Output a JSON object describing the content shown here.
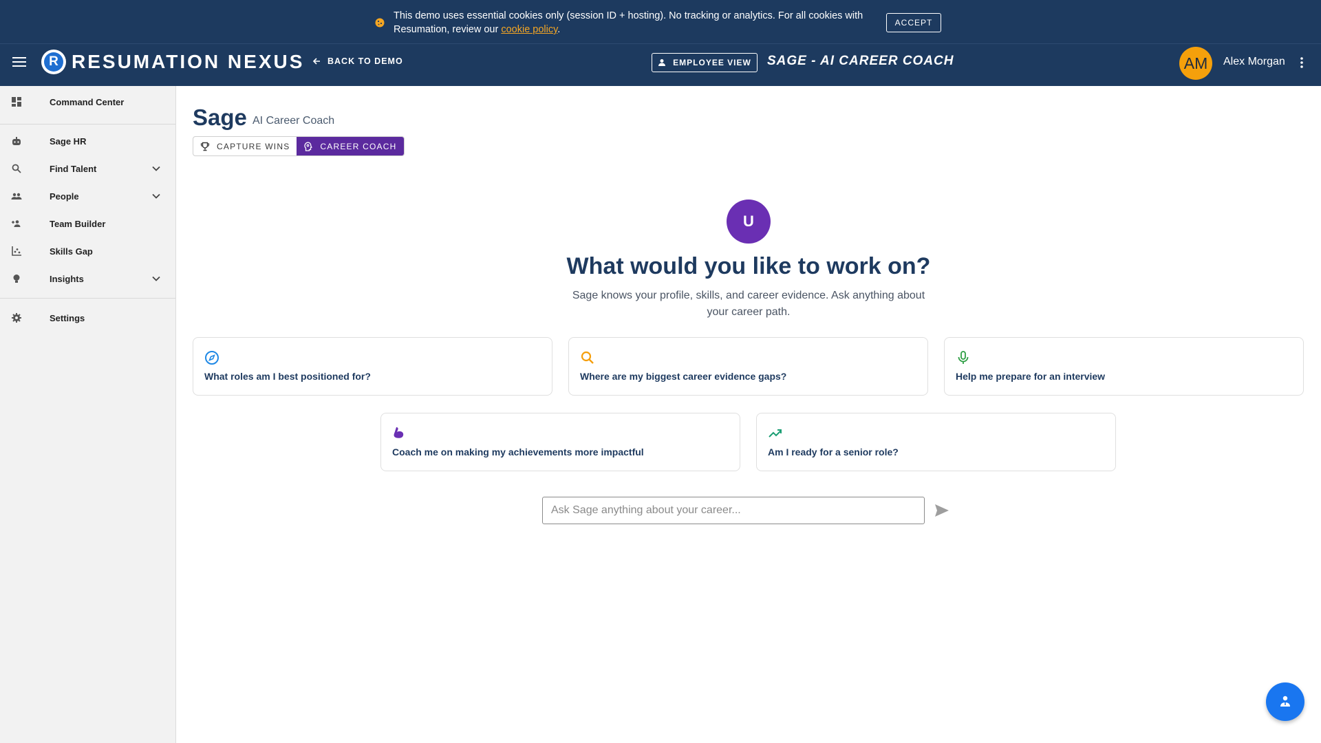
{
  "cookie_banner": {
    "text_before_link": "This demo uses essential cookies only (session ID + hosting). No tracking or analytics. For all cookies with Resumation, review our ",
    "link_text": "cookie policy",
    "text_after_link": ".",
    "accept_label": "ACCEPT",
    "icon": "cookie-icon"
  },
  "header": {
    "logo_letter": "R",
    "brand": "RESUMATION NEXUS",
    "back_label": "BACK TO DEMO",
    "view_button_label": "EMPLOYEE VIEW",
    "page_heading": "SAGE - AI CAREER COACH",
    "user_initials": "AM",
    "user_name": "Alex Morgan",
    "accent_color": "#f5a00b",
    "bar_color": "#1d3a5f"
  },
  "sidebar": {
    "items": [
      {
        "label": "Command Center",
        "icon": "dashboard-icon",
        "expandable": false
      },
      {
        "label": "Sage HR",
        "icon": "robot-icon",
        "expandable": false
      },
      {
        "label": "Find Talent",
        "icon": "search-icon",
        "expandable": true
      },
      {
        "label": "People",
        "icon": "people-icon",
        "expandable": true
      },
      {
        "label": "Team Builder",
        "icon": "group-add-icon",
        "expandable": false
      },
      {
        "label": "Skills Gap",
        "icon": "chart-icon",
        "expandable": false
      },
      {
        "label": "Insights",
        "icon": "lightbulb-icon",
        "expandable": true
      },
      {
        "label": "Settings",
        "icon": "gear-icon",
        "expandable": false
      }
    ]
  },
  "main": {
    "title": "Sage",
    "subtitle": "AI Career Coach",
    "toggle": [
      {
        "label": "CAPTURE WINS",
        "icon": "trophy-icon",
        "active": false
      },
      {
        "label": "CAREER COACH",
        "icon": "psychology-icon",
        "active": true
      }
    ],
    "hero_avatar_letter": "U",
    "hero_title": "What would you like to work on?",
    "hero_subtitle": "Sage knows your profile, skills, and career evidence. Ask anything about your career path.",
    "suggestions": [
      {
        "label": "What roles am I best positioned for?",
        "icon": "compass-icon",
        "color": "#1e88e5"
      },
      {
        "label": "Where are my biggest career evidence gaps?",
        "icon": "search-icon",
        "color": "#f59e0b"
      },
      {
        "label": "Help me prepare for an interview",
        "icon": "microphone-icon",
        "color": "#2e9e44"
      },
      {
        "label": "Coach me on making my achievements more impactful",
        "icon": "muscle-icon",
        "color": "#6a2fb3"
      },
      {
        "label": "Am I ready for a senior role?",
        "icon": "trending-up-icon",
        "color": "#1a9e73"
      }
    ],
    "chat_placeholder": "Ask Sage anything about your career..."
  }
}
